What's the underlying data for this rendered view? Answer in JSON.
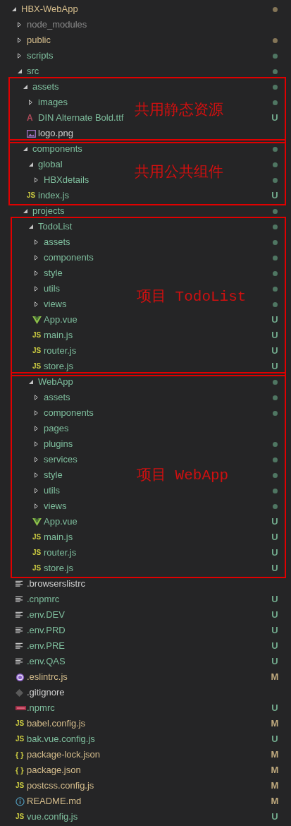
{
  "explorer": {
    "tree": [
      {
        "name": "HBX-WebApp",
        "kind": "folder",
        "expanded": true,
        "color": "#d5bd8c",
        "dot": true,
        "children": [
          {
            "name": "node_modules",
            "kind": "folder",
            "expanded": false,
            "color": "#8a8a8a",
            "dot": false
          },
          {
            "name": "public",
            "kind": "folder",
            "expanded": false,
            "color": "#d5bd8c",
            "dot": true
          },
          {
            "name": "scripts",
            "kind": "folder",
            "expanded": false,
            "color": "#7fbf9e",
            "dot": true
          },
          {
            "name": "src",
            "kind": "folder",
            "expanded": true,
            "color": "#7fbf9e",
            "dot": true,
            "children": [
              {
                "name": "assets",
                "kind": "folder",
                "expanded": true,
                "color": "#7fbf9e",
                "dot": true,
                "annotation": "共用静态资源",
                "children": [
                  {
                    "name": "images",
                    "kind": "folder",
                    "expanded": false,
                    "color": "#7fbf9e",
                    "dot": true
                  },
                  {
                    "name": "DIN Alternate Bold.ttf",
                    "kind": "font",
                    "glyph": "A",
                    "color": "#7fbf9e",
                    "badge": "U"
                  },
                  {
                    "name": "logo.png",
                    "kind": "image",
                    "color": "#cfcfcf"
                  }
                ]
              },
              {
                "name": "components",
                "kind": "folder",
                "expanded": true,
                "color": "#7fbf9e",
                "dot": true,
                "annotation": "共用公共组件",
                "children": [
                  {
                    "name": "global",
                    "kind": "folder",
                    "expanded": true,
                    "color": "#7fbf9e",
                    "dot": true,
                    "children": [
                      {
                        "name": "HBXdetails",
                        "kind": "folder",
                        "expanded": false,
                        "color": "#7fbf9e",
                        "dot": true
                      }
                    ]
                  },
                  {
                    "name": "index.js",
                    "kind": "js",
                    "glyph": "JS",
                    "color": "#7fbf9e",
                    "badge": "U"
                  }
                ]
              },
              {
                "name": "projects",
                "kind": "folder",
                "expanded": true,
                "color": "#7fbf9e",
                "dot": true,
                "children": [
                  {
                    "name": "TodoList",
                    "kind": "folder",
                    "expanded": true,
                    "color": "#7fbf9e",
                    "dot": true,
                    "annotation": "项目 TodoList",
                    "children": [
                      {
                        "name": "assets",
                        "kind": "folder",
                        "expanded": false,
                        "color": "#7fbf9e",
                        "dot": true
                      },
                      {
                        "name": "components",
                        "kind": "folder",
                        "expanded": false,
                        "color": "#7fbf9e",
                        "dot": true
                      },
                      {
                        "name": "style",
                        "kind": "folder",
                        "expanded": false,
                        "color": "#7fbf9e",
                        "dot": true
                      },
                      {
                        "name": "utils",
                        "kind": "folder",
                        "expanded": false,
                        "color": "#7fbf9e",
                        "dot": true
                      },
                      {
                        "name": "views",
                        "kind": "folder",
                        "expanded": false,
                        "color": "#7fbf9e",
                        "dot": true
                      },
                      {
                        "name": "App.vue",
                        "kind": "vue",
                        "color": "#7fbf9e",
                        "badge": "U"
                      },
                      {
                        "name": "main.js",
                        "kind": "js",
                        "glyph": "JS",
                        "color": "#7fbf9e",
                        "badge": "U"
                      },
                      {
                        "name": "router.js",
                        "kind": "js",
                        "glyph": "JS",
                        "color": "#7fbf9e",
                        "badge": "U"
                      },
                      {
                        "name": "store.js",
                        "kind": "js",
                        "glyph": "JS",
                        "color": "#7fbf9e",
                        "badge": "U"
                      }
                    ]
                  },
                  {
                    "name": "WebApp",
                    "kind": "folder",
                    "expanded": true,
                    "color": "#7fbf9e",
                    "dot": true,
                    "annotation": "项目 WebApp",
                    "children": [
                      {
                        "name": "assets",
                        "kind": "folder",
                        "expanded": false,
                        "color": "#7fbf9e",
                        "dot": true
                      },
                      {
                        "name": "components",
                        "kind": "folder",
                        "expanded": false,
                        "color": "#7fbf9e",
                        "dot": true
                      },
                      {
                        "name": "pages",
                        "kind": "folder",
                        "expanded": false,
                        "color": "#7fbf9e",
                        "dot": false
                      },
                      {
                        "name": "plugins",
                        "kind": "folder",
                        "expanded": false,
                        "color": "#7fbf9e",
                        "dot": true
                      },
                      {
                        "name": "services",
                        "kind": "folder",
                        "expanded": false,
                        "color": "#7fbf9e",
                        "dot": true
                      },
                      {
                        "name": "style",
                        "kind": "folder",
                        "expanded": false,
                        "color": "#7fbf9e",
                        "dot": true
                      },
                      {
                        "name": "utils",
                        "kind": "folder",
                        "expanded": false,
                        "color": "#7fbf9e",
                        "dot": true
                      },
                      {
                        "name": "views",
                        "kind": "folder",
                        "expanded": false,
                        "color": "#7fbf9e",
                        "dot": true
                      },
                      {
                        "name": "App.vue",
                        "kind": "vue",
                        "color": "#7fbf9e",
                        "badge": "U"
                      },
                      {
                        "name": "main.js",
                        "kind": "js",
                        "glyph": "JS",
                        "color": "#7fbf9e",
                        "badge": "U"
                      },
                      {
                        "name": "router.js",
                        "kind": "js",
                        "glyph": "JS",
                        "color": "#7fbf9e",
                        "badge": "U"
                      },
                      {
                        "name": "store.js",
                        "kind": "js",
                        "glyph": "JS",
                        "color": "#7fbf9e",
                        "badge": "U"
                      }
                    ]
                  }
                ]
              }
            ]
          },
          {
            "name": ".browserslistrc",
            "kind": "lines",
            "color": "#cfcfcf"
          },
          {
            "name": ".cnpmrc",
            "kind": "lines",
            "color": "#7fbf9e",
            "badge": "U"
          },
          {
            "name": ".env.DEV",
            "kind": "lines",
            "color": "#7fbf9e",
            "badge": "U"
          },
          {
            "name": ".env.PRD",
            "kind": "lines",
            "color": "#7fbf9e",
            "badge": "U"
          },
          {
            "name": ".env.PRE",
            "kind": "lines",
            "color": "#7fbf9e",
            "badge": "U"
          },
          {
            "name": ".env.QAS",
            "kind": "lines",
            "color": "#7fbf9e",
            "badge": "U"
          },
          {
            "name": ".eslintrc.js",
            "kind": "ring",
            "color": "#d5bd8c",
            "badge": "M"
          },
          {
            "name": ".gitignore",
            "kind": "diamond",
            "color": "#cfcfcf"
          },
          {
            "name": ".npmrc",
            "kind": "tag",
            "color": "#7fbf9e",
            "badge": "U"
          },
          {
            "name": "babel.config.js",
            "kind": "js",
            "glyph": "JS",
            "color": "#d5bd8c",
            "badge": "M"
          },
          {
            "name": "bak.vue.config.js",
            "kind": "js",
            "glyph": "JS",
            "color": "#7fbf9e",
            "badge": "U"
          },
          {
            "name": "package-lock.json",
            "kind": "json",
            "glyph": "{ }",
            "color": "#d5bd8c",
            "badge": "M"
          },
          {
            "name": "package.json",
            "kind": "json",
            "glyph": "{ }",
            "color": "#d5bd8c",
            "badge": "M"
          },
          {
            "name": "postcss.config.js",
            "kind": "js",
            "glyph": "JS",
            "color": "#d5bd8c",
            "badge": "M"
          },
          {
            "name": "README.md",
            "kind": "info",
            "color": "#d5bd8c",
            "badge": "M"
          },
          {
            "name": "vue.config.js",
            "kind": "js",
            "glyph": "JS",
            "color": "#7fbf9e",
            "badge": "U"
          }
        ]
      }
    ]
  }
}
